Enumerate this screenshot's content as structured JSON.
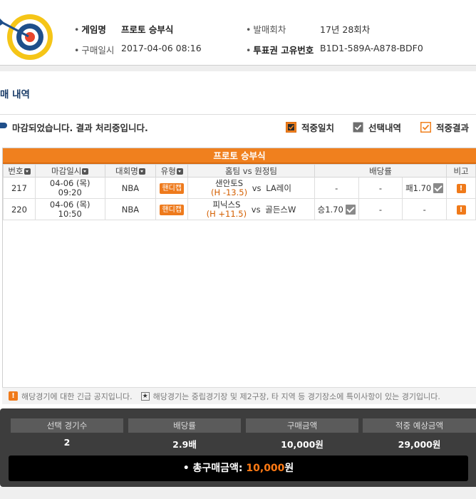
{
  "header": {
    "game_label": "게임명",
    "game_value": "프로토 승부식",
    "purchase_time_label": "구매일시",
    "purchase_time_value": "2017-04-06 08:16",
    "round_label": "발매회차",
    "round_value": "17년 28회차",
    "ticket_id_label": "투표권 고유번호",
    "ticket_id_value": "B1D1-589A-A878-BDF0"
  },
  "section_title": "매 내역",
  "status_message": "마감되었습니다. 결과 처리중입니다.",
  "legend": {
    "hit": "적중일치",
    "selected": "선택내역",
    "result": "적중결과"
  },
  "table": {
    "title": "프로토 승부식",
    "columns": [
      "번호",
      "마감일시",
      "대회명",
      "유형",
      "홈팀 vs 원정팀",
      "배당률",
      "비고"
    ],
    "rows": [
      {
        "number": "217",
        "date": "04-06 (목)",
        "time": "09:20",
        "league": "NBA",
        "type": "핸디캡",
        "home": "샌안토S",
        "handicap": "(H -13.5)",
        "vs": "vs",
        "away": "LA레이",
        "odds1": "-",
        "odds2": "-",
        "odds3": "패1.70",
        "note": "!"
      },
      {
        "number": "220",
        "date": "04-06 (목)",
        "time": "10:50",
        "league": "NBA",
        "type": "핸디캡",
        "home": "피닉스S",
        "handicap": "(H +11.5)",
        "vs": "vs",
        "away": "골든스W",
        "odds1": "승1.70",
        "odds2": "-",
        "odds3": "-",
        "note": "!"
      }
    ]
  },
  "notice": {
    "urgent": "해당경기에 대한 긴급 공지입니다.",
    "special": "해당경기는 중립경기장 및 제2구장, 타 지역 등 경기장소에 특이사항이 있는 경기입니다.",
    "urgent_icon": "!",
    "special_icon": "★"
  },
  "summary": {
    "headers": [
      "선택 경기수",
      "배당률",
      "구매금액",
      "적중 예상금액"
    ],
    "values": [
      "2",
      "2.9배",
      "10,000원",
      "29,000원"
    ],
    "total_label": "총구매금액: ",
    "total_amount": "10,000",
    "total_unit": "원"
  },
  "colors": {
    "accent": "#f0801e",
    "section_title": "#1b3d69",
    "summary_bg": "#3d3d3d"
  }
}
